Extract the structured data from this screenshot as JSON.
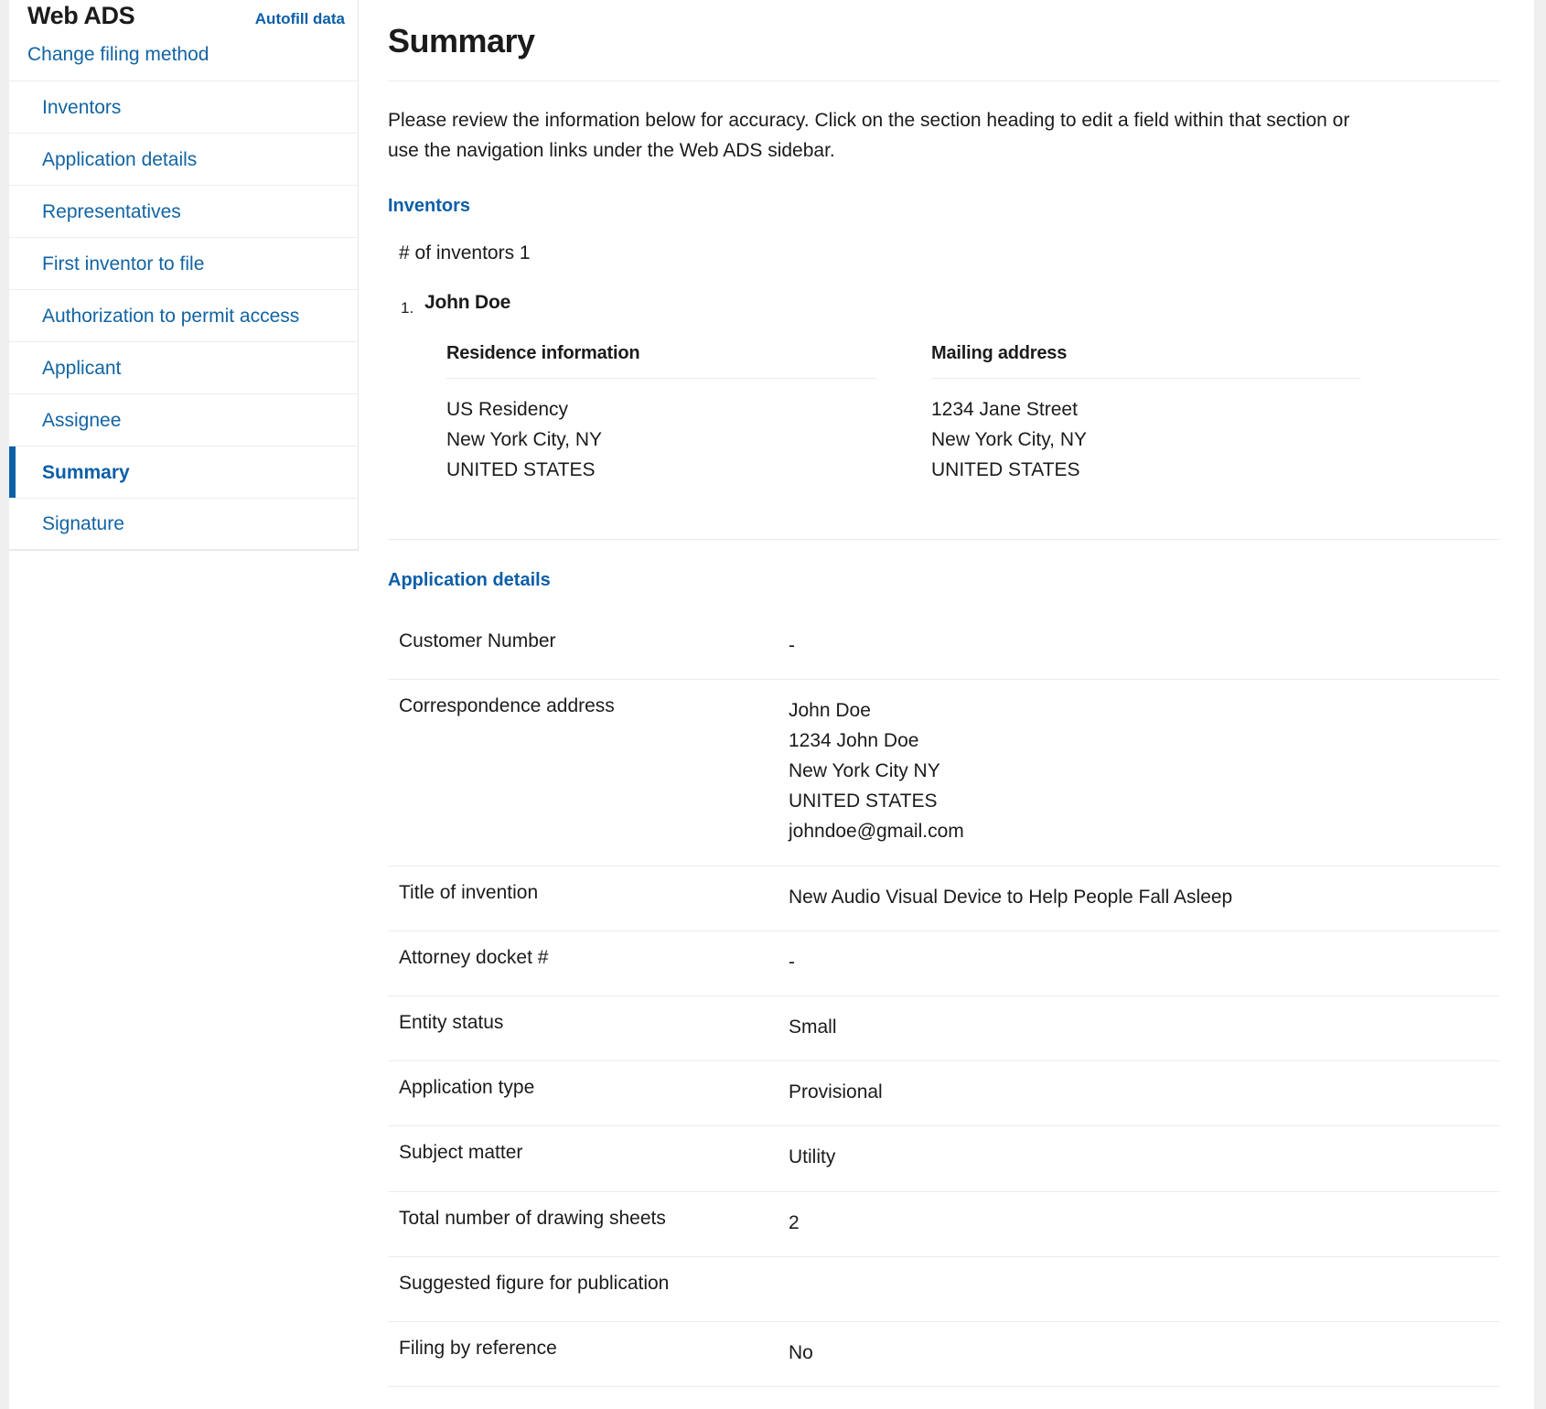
{
  "sidebar": {
    "brand": "Web ADS",
    "autofill_label": "Autofill data",
    "change_filing_method": "Change filing method",
    "items": [
      {
        "label": "Inventors",
        "active": false
      },
      {
        "label": "Application details",
        "active": false
      },
      {
        "label": "Representatives",
        "active": false
      },
      {
        "label": "First inventor to file",
        "active": false
      },
      {
        "label": "Authorization to permit access",
        "active": false
      },
      {
        "label": "Applicant",
        "active": false
      },
      {
        "label": "Assignee",
        "active": false
      },
      {
        "label": "Summary",
        "active": true
      },
      {
        "label": "Signature",
        "active": false
      }
    ]
  },
  "main": {
    "title": "Summary",
    "intro": "Please review the information below for accuracy. Click on the section heading to edit a field within that section or use the navigation links under the Web ADS sidebar.",
    "inventors_section": {
      "heading": "Inventors",
      "count_label": "# of inventors 1",
      "inventors": [
        {
          "index": "1.",
          "name": "John Doe",
          "residence_title": "Residence information",
          "residence_lines": [
            "US Residency",
            "New York City, NY",
            "UNITED STATES"
          ],
          "mailing_title": "Mailing address",
          "mailing_lines": [
            "1234 Jane Street",
            "New York City, NY",
            "UNITED STATES"
          ]
        }
      ]
    },
    "application_details_section": {
      "heading": "Application details",
      "rows": [
        {
          "label": "Customer Number",
          "value_lines": [
            "-"
          ]
        },
        {
          "label": "Correspondence address",
          "value_lines": [
            "John Doe",
            "1234 John Doe",
            "New York City NY",
            "UNITED STATES",
            "johndoe@gmail.com"
          ]
        },
        {
          "label": "Title of invention",
          "value_lines": [
            "New Audio Visual Device to Help People Fall Asleep"
          ]
        },
        {
          "label": "Attorney docket #",
          "value_lines": [
            "-"
          ]
        },
        {
          "label": "Entity status",
          "value_lines": [
            "Small"
          ]
        },
        {
          "label": "Application type",
          "value_lines": [
            "Provisional"
          ]
        },
        {
          "label": "Subject matter",
          "value_lines": [
            "Utility"
          ]
        },
        {
          "label": "Total number of drawing sheets",
          "value_lines": [
            "2"
          ]
        },
        {
          "label": "Suggested figure for publication",
          "value_lines": [
            ""
          ]
        },
        {
          "label": "Filing by reference",
          "value_lines": [
            "No"
          ]
        }
      ]
    }
  },
  "colors": {
    "link_blue": "#1264a3",
    "accent_blue": "#0b5ea8",
    "text": "#1b1b1b",
    "divider": "#ececec",
    "gutter": "#efefef"
  }
}
